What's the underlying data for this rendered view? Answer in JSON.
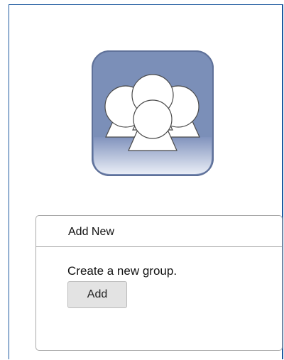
{
  "icon": {
    "name": "group-icon",
    "background_color": "#7b8fb8",
    "border_color": "#5f7199",
    "silhouette_fill": "#ffffff",
    "silhouette_stroke": "#4a4a4a"
  },
  "panel": {
    "title": "Add New",
    "description": "Create a new group.",
    "add_label": "Add"
  },
  "colors": {
    "frame_border": "#1f5aa0",
    "panel_border": "#a9a9a9",
    "button_bg": "#e3e3e3"
  }
}
